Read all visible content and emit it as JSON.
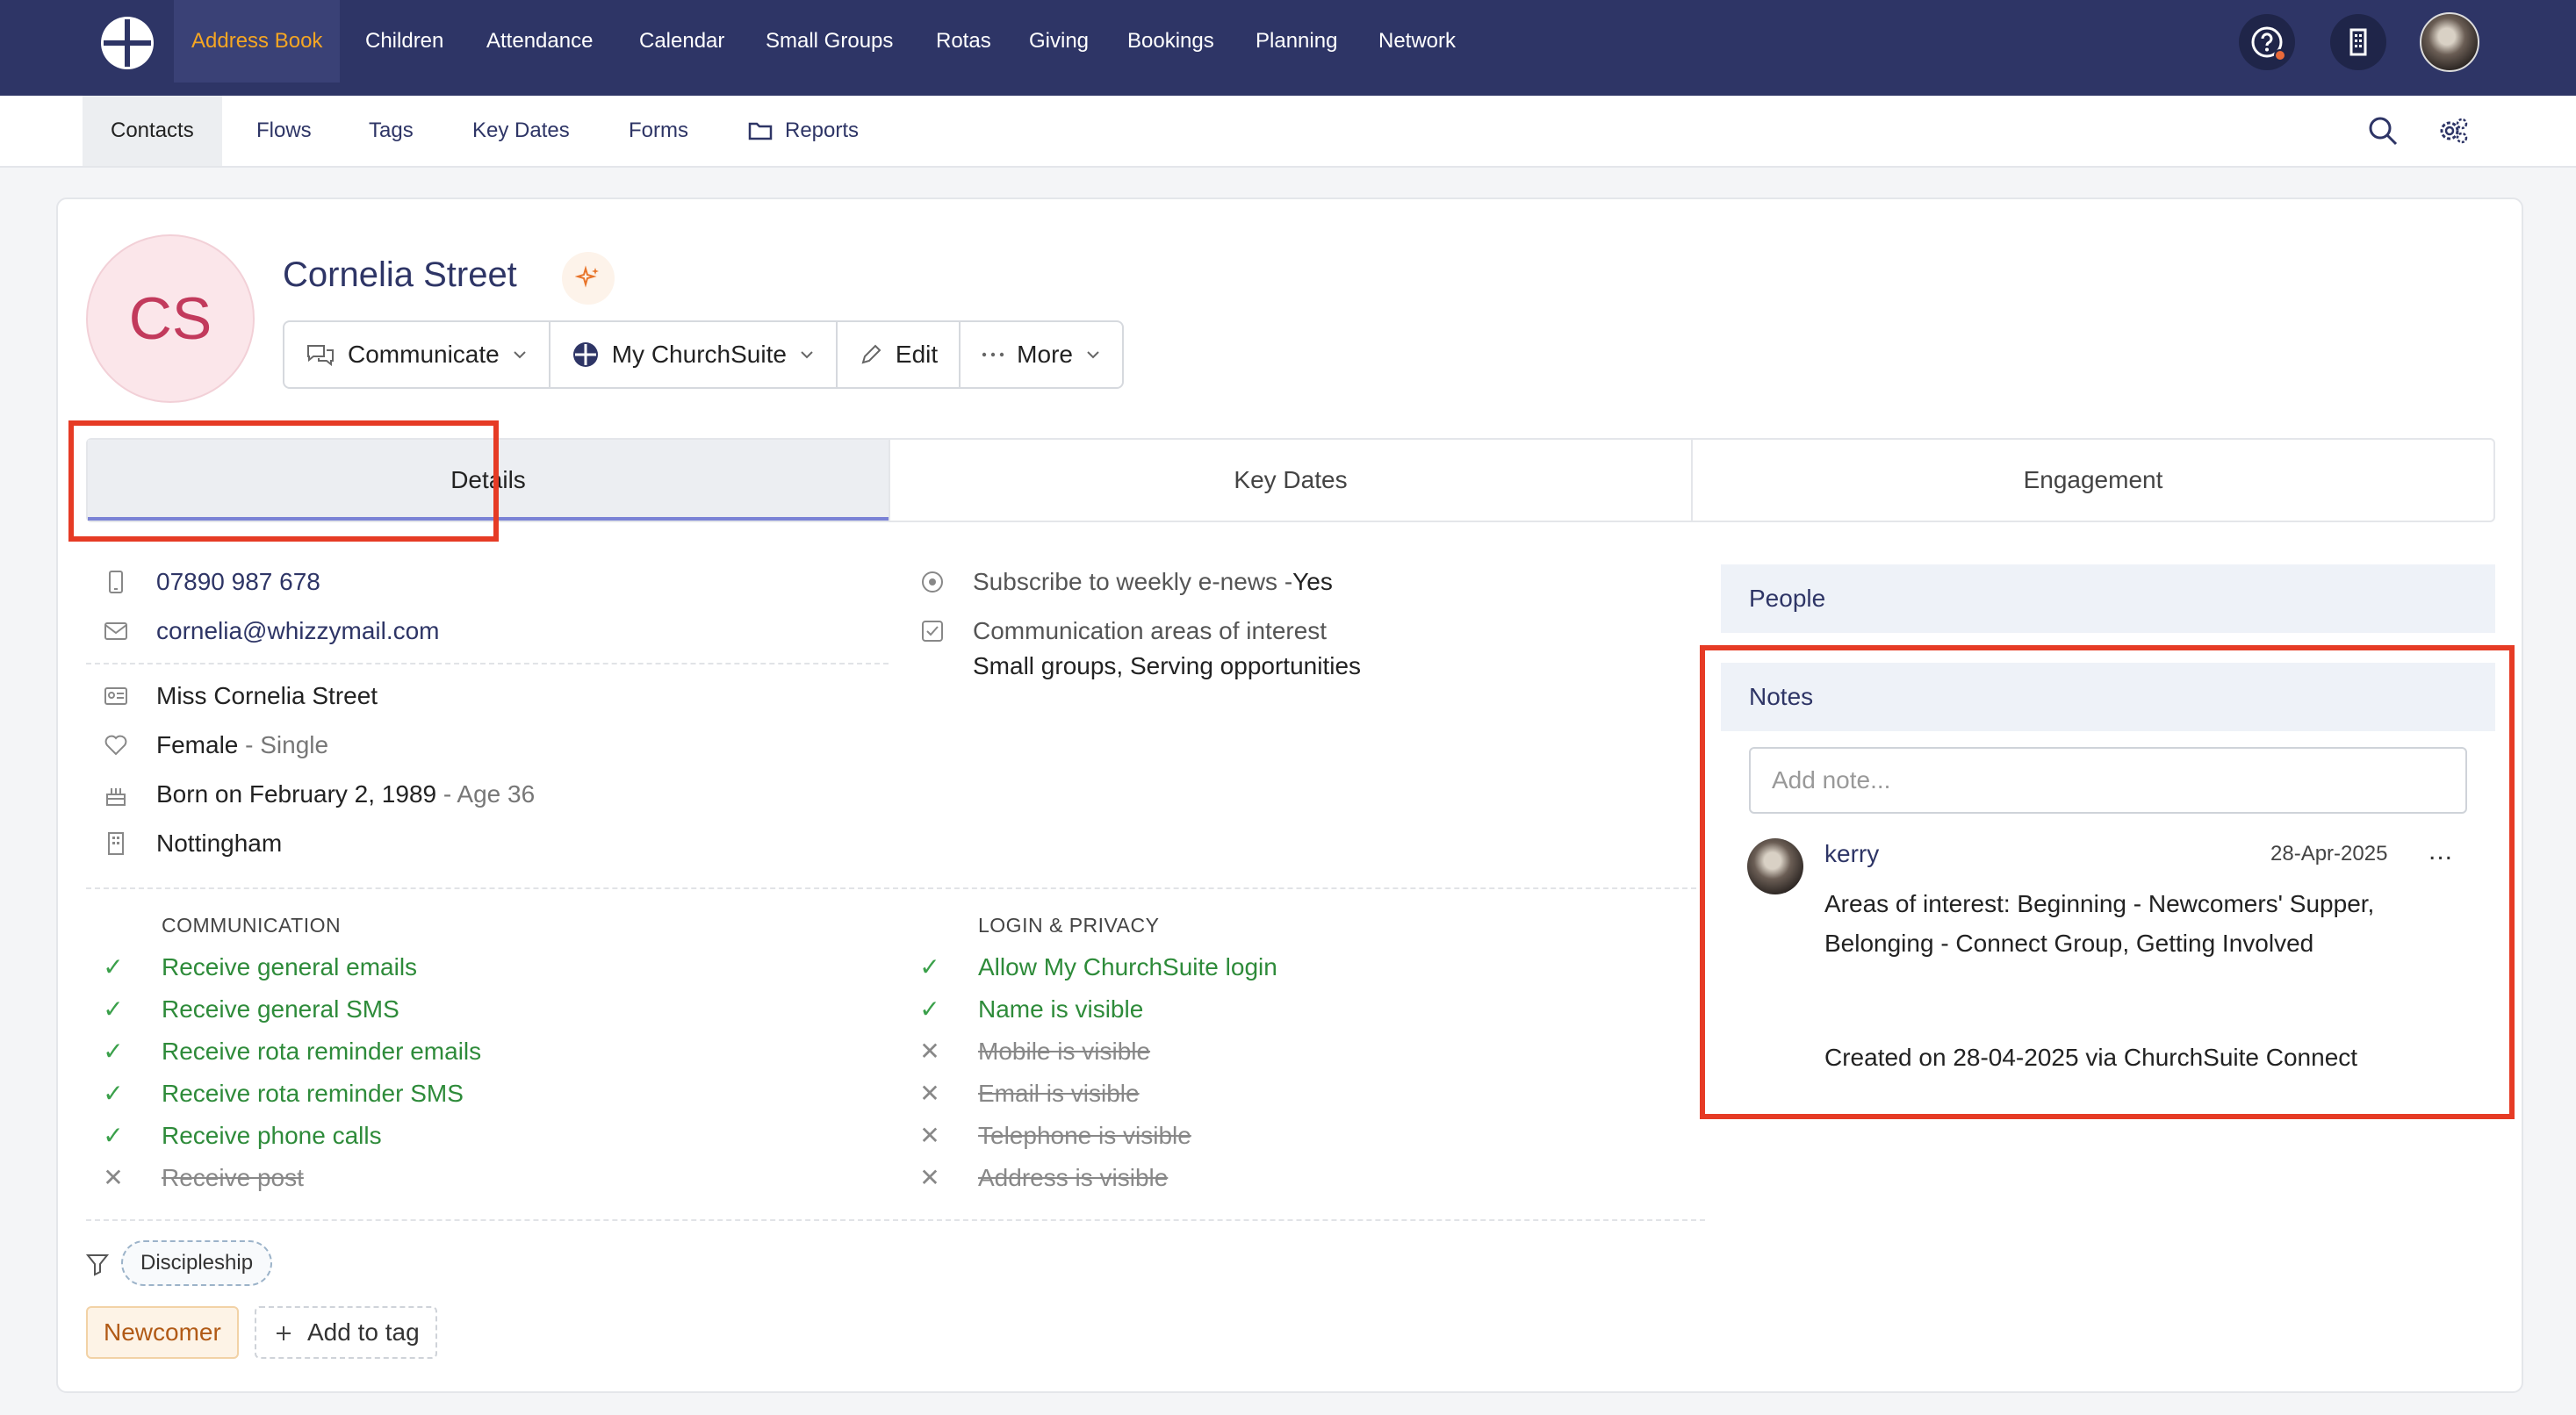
{
  "topnav": {
    "items": [
      "Address Book",
      "Children",
      "Attendance",
      "Calendar",
      "Small Groups",
      "Rotas",
      "Giving",
      "Bookings",
      "Planning",
      "Network"
    ]
  },
  "subnav": {
    "items": [
      "Contacts",
      "Flows",
      "Tags",
      "Key Dates",
      "Forms",
      "Reports"
    ]
  },
  "contact": {
    "initials": "CS",
    "name": "Cornelia Street"
  },
  "actions": {
    "communicate": "Communicate",
    "my_churchsuite": "My ChurchSuite",
    "edit": "Edit",
    "more": "More"
  },
  "tabs": [
    "Details",
    "Key Dates",
    "Engagement"
  ],
  "details": {
    "phone": "07890 987 678",
    "email": "cornelia@whizzymail.com",
    "full_name": "Miss Cornelia Street",
    "sex": "Female",
    "marital": "- Single",
    "born": "Born on February 2, 1989",
    "age": "- Age 36",
    "city": "Nottingham",
    "enews_label": "Subscribe to weekly e-news - ",
    "enews_value": "Yes",
    "interest_label": "Communication areas of interest",
    "interest_value": "Small groups, Serving opportunities"
  },
  "communication": {
    "title": "COMMUNICATION",
    "items": [
      {
        "label": "Receive general emails",
        "enabled": true
      },
      {
        "label": "Receive general SMS",
        "enabled": true
      },
      {
        "label": "Receive rota reminder emails",
        "enabled": true
      },
      {
        "label": "Receive rota reminder SMS",
        "enabled": true
      },
      {
        "label": "Receive phone calls",
        "enabled": true
      },
      {
        "label": "Receive post",
        "enabled": false
      }
    ]
  },
  "privacy": {
    "title": "LOGIN & PRIVACY",
    "items": [
      {
        "label": "Allow My ChurchSuite login",
        "enabled": true
      },
      {
        "label": "Name is visible",
        "enabled": true
      },
      {
        "label": "Mobile is visible",
        "enabled": false
      },
      {
        "label": "Email is visible",
        "enabled": false
      },
      {
        "label": "Telephone is visible",
        "enabled": false
      },
      {
        "label": "Address is visible",
        "enabled": false
      }
    ]
  },
  "tags": {
    "filter_pill": "Discipleship",
    "tag": "Newcomer",
    "add_tag": "Add to tag"
  },
  "people": {
    "title": "People"
  },
  "notes": {
    "title": "Notes",
    "placeholder": "Add note...",
    "note": {
      "author": "kerry",
      "date": "28-Apr-2025",
      "more": "...",
      "body": "Areas of interest: Beginning - Newcomers' Supper, Belonging - Connect Group, Getting Involved",
      "created": "Created on 28-04-2025 via ChurchSuite Connect"
    }
  },
  "colors": {
    "nav_bg": "#2e3566",
    "nav_active": "#f5a623",
    "highlight": "#e63b25",
    "enabled_green": "#2e8b3a"
  }
}
